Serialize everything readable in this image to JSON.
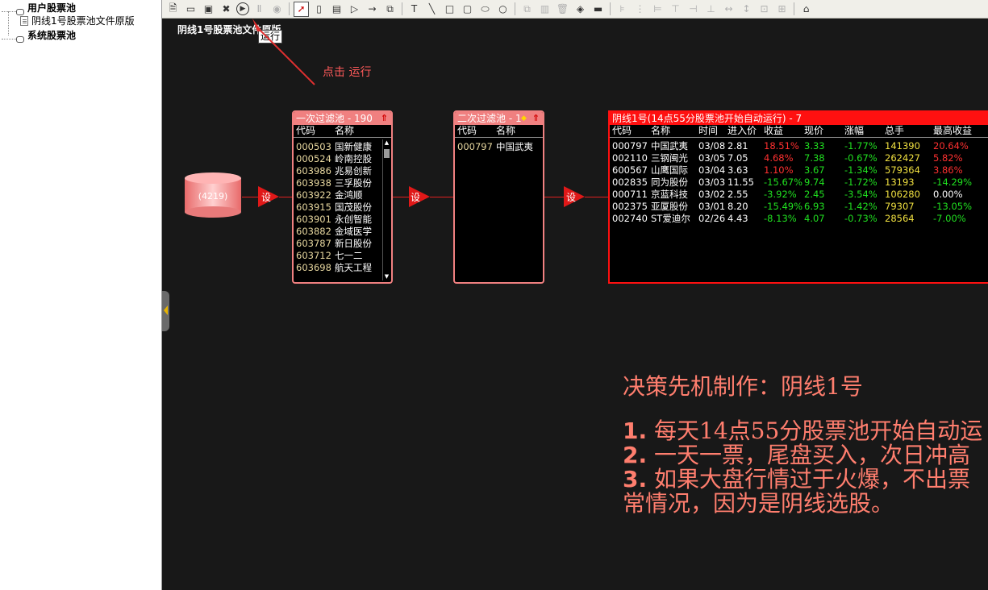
{
  "tree": {
    "user_pool": "用户股票池",
    "user_pool_child": "阴线1号股票池文件原版",
    "system_pool": "系统股票池"
  },
  "toolbar": {
    "run_tooltip": "运行"
  },
  "canvas": {
    "title": "阴线1号股票池文件原版",
    "click_hint": "点击 运行",
    "db_count": "(4219)",
    "setter_label": "设"
  },
  "filter1": {
    "title": "一次过滤池 - 190",
    "col_code": "代码",
    "col_name": "名称",
    "rows": [
      {
        "code": "000503",
        "name": "国新健康"
      },
      {
        "code": "000524",
        "name": "岭南控股"
      },
      {
        "code": "603986",
        "name": "兆易创新"
      },
      {
        "code": "603938",
        "name": "三孚股份"
      },
      {
        "code": "603922",
        "name": "金鸿顺"
      },
      {
        "code": "603915",
        "name": "国茂股份"
      },
      {
        "code": "603901",
        "name": "永创智能"
      },
      {
        "code": "603882",
        "name": "金域医学"
      },
      {
        "code": "603787",
        "name": "新日股份"
      },
      {
        "code": "603712",
        "name": "七一二"
      },
      {
        "code": "603698",
        "name": "航天工程"
      }
    ]
  },
  "filter2": {
    "title": "二次过滤池 - 1",
    "col_code": "代码",
    "col_name": "名称",
    "rows": [
      {
        "code": "000797",
        "name": "中国武夷"
      }
    ]
  },
  "result": {
    "title": "阴线1号(14点55分股票池开始自动运行) - 7",
    "cols": [
      "代码",
      "名称",
      "时间",
      "进入价",
      "收益",
      "现价",
      "涨幅",
      "总手",
      "最高收益"
    ],
    "rows": [
      {
        "code": "000797",
        "name": "中国武夷",
        "time": "03/08",
        "entry": "2.81",
        "gain": "18.51%",
        "price": "3.33",
        "change": "-1.77%",
        "volume": "141390",
        "max_gain": "20.64%"
      },
      {
        "code": "002110",
        "name": "三钢闽光",
        "time": "03/05",
        "entry": "7.05",
        "gain": "4.68%",
        "price": "7.38",
        "change": "-0.67%",
        "volume": "262427",
        "max_gain": "5.82%"
      },
      {
        "code": "600567",
        "name": "山鹰国际",
        "time": "03/04",
        "entry": "3.63",
        "gain": "1.10%",
        "price": "3.67",
        "change": "-1.34%",
        "volume": "579364",
        "max_gain": "3.86%"
      },
      {
        "code": "002835",
        "name": "同为股份",
        "time": "03/03",
        "entry": "11.55",
        "gain": "-15.67%",
        "price": "9.74",
        "change": "-1.72%",
        "volume": "13193",
        "max_gain": "-14.29%"
      },
      {
        "code": "000711",
        "name": "京蓝科技",
        "time": "03/02",
        "entry": "2.55",
        "gain": "-3.92%",
        "price": "2.45",
        "change": "-3.54%",
        "volume": "106280",
        "max_gain": "0.00%"
      },
      {
        "code": "002375",
        "name": "亚厦股份",
        "time": "03/01",
        "entry": "8.20",
        "gain": "-15.49%",
        "price": "6.93",
        "change": "-1.42%",
        "volume": "79307",
        "max_gain": "-13.05%"
      },
      {
        "code": "002740",
        "name": "ST爱迪尔",
        "time": "02/26",
        "entry": "4.43",
        "gain": "-8.13%",
        "price": "4.07",
        "change": "-0.73%",
        "volume": "28564",
        "max_gain": "-7.00%"
      }
    ]
  },
  "notes": {
    "title": "决策先机制作：阴线1号",
    "line1_num": "1.",
    "line1_text": "每天14点55分股票池开始自动运",
    "line2_num": "2.",
    "line2_text": "一天一票，尾盘买入，次日冲高",
    "line3_num": "3.",
    "line3_text": "如果大盘行情过于火爆，不出票",
    "line4_text": "常情况，因为是阴线选股。"
  },
  "colors": {
    "canvas_bg": "#181818",
    "pool_border": "#f08080",
    "result_border": "#ff1010",
    "note_text": "#ff7e6e",
    "positive": "#ff3030",
    "negative": "#20e020"
  }
}
